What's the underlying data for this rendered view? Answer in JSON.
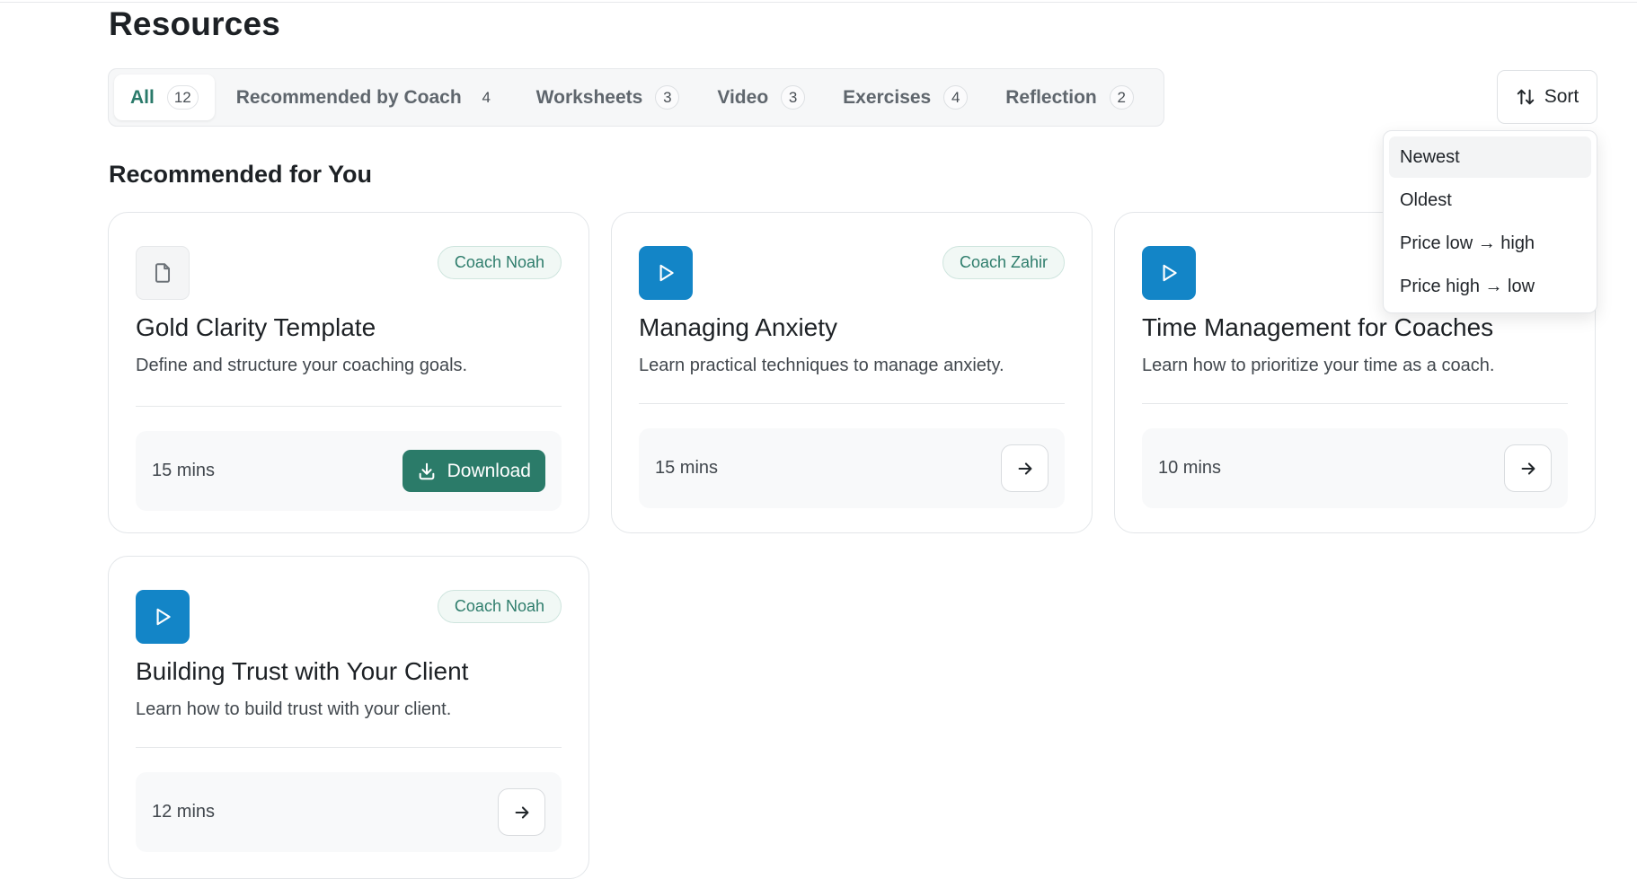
{
  "page": {
    "title": "Resources"
  },
  "tabs": [
    {
      "label": "All",
      "count": "12"
    },
    {
      "label": "Recommended by Coach",
      "count": "4"
    },
    {
      "label": "Worksheets",
      "count": "3"
    },
    {
      "label": "Video",
      "count": "3"
    },
    {
      "label": "Exercises",
      "count": "4"
    },
    {
      "label": "Reflection",
      "count": "2"
    }
  ],
  "sort": {
    "label": "Sort",
    "options": [
      "Newest",
      "Oldest",
      "Price low → high",
      "Price high → low"
    ]
  },
  "section": {
    "title": "Recommended for You"
  },
  "cards": [
    {
      "icon": "document-icon",
      "coach": "Coach Noah",
      "title": "Gold Clarity Template",
      "description": "Define and structure your coaching goals.",
      "duration": "15 mins",
      "action": "Download"
    },
    {
      "icon": "play-icon",
      "coach": "Coach Zahir",
      "title": "Managing Anxiety",
      "description": "Learn practical techniques to manage anxiety.",
      "duration": "15 mins"
    },
    {
      "icon": "play-icon",
      "coach": "",
      "title": "Time Management for Coaches",
      "description": "Learn how to prioritize your time as a coach.",
      "duration": "10 mins"
    },
    {
      "icon": "play-icon",
      "coach": "Coach Noah",
      "title": "Building Trust with Your Client",
      "description": "Learn how to build trust with your client.",
      "duration": "12 mins"
    }
  ],
  "colors": {
    "accent": "#2b7b69",
    "video_icon_bg": "#1385c7",
    "badge_text": "#2e7d6c"
  }
}
